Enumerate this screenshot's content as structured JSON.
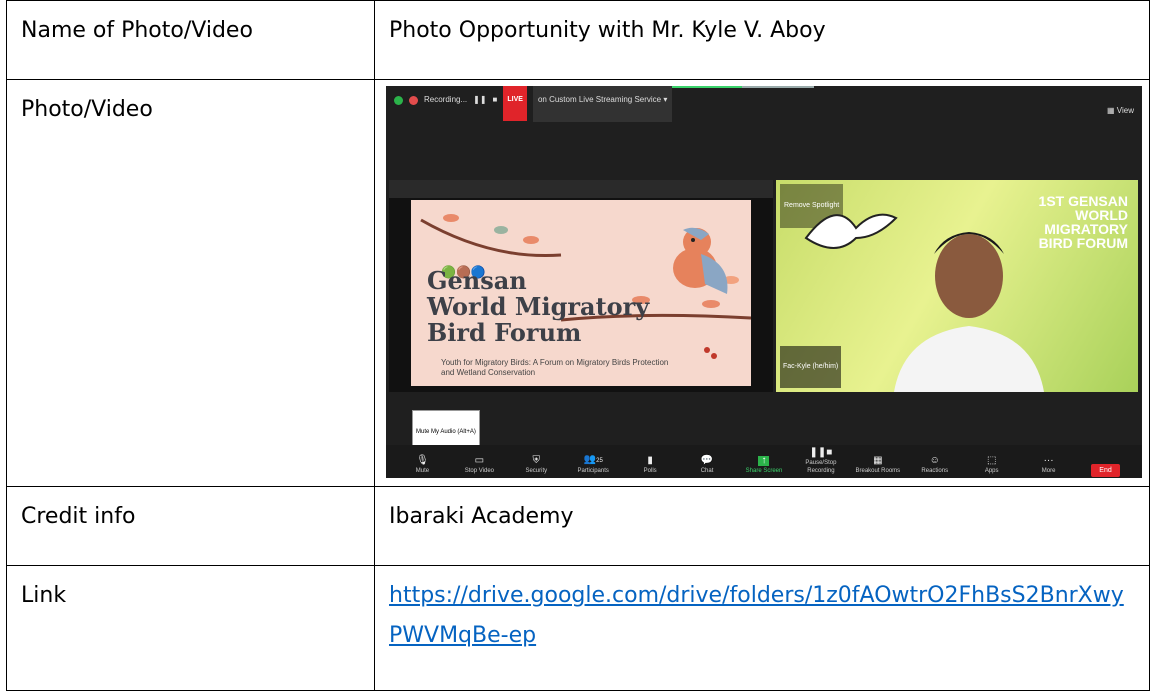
{
  "table": {
    "row1": {
      "label": "Name of Photo/Video",
      "value": "Photo Opportunity with Mr. Kyle V. Aboy"
    },
    "row2": {
      "label": "Photo/Video"
    },
    "row3": {
      "label": "Credit info",
      "value": "Ibaraki Academy"
    },
    "row4": {
      "label": "Link",
      "value": "https://drive.google.com/drive/folders/1z0fAOwtrO2FhBsS2BnrXwyPWVMqBe-ep"
    }
  },
  "zoom": {
    "recording": "Recording...",
    "live": "LIVE",
    "stream": "on Custom Live Streaming Service",
    "view": "View",
    "slide_title_1": "Gensan",
    "slide_title_2": "World Migratory",
    "slide_title_3": "Bird Forum",
    "slide_subtitle": "Youth for Migratory Birds: A Forum on Migratory Birds Protection and Wetland Conservation",
    "cam_title_1": "1ST GENSAN",
    "cam_title_2": "WORLD",
    "cam_title_3": "MIGRATORY",
    "cam_title_4": "BIRD FORUM",
    "spotlight": "Remove Spotlight",
    "cam_name": "Fac-Kyle (he/him)",
    "tooltip": "Mute My Audio (Alt+A)",
    "participants_count": "25",
    "toolbar": [
      "Mute",
      "Stop Video",
      "Security",
      "Participants",
      "Polls",
      "Chat",
      "Share Screen",
      "Pause/Stop Recording",
      "Breakout Rooms",
      "Reactions",
      "Apps",
      "More"
    ],
    "end": "End"
  }
}
